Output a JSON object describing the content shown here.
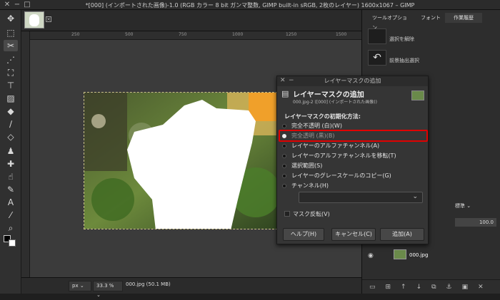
{
  "window": {
    "title": "*[000] (インポートされた画像)-1.0 (RGB カラー 8 bit ガンマ整数, GIMP built-in sRGB, 2枚のレイヤー) 1600x1067 – GIMP"
  },
  "ruler": {
    "h_labels": [
      "250",
      "500",
      "750",
      "1000",
      "1250",
      "1500"
    ]
  },
  "statusbar": {
    "unit": "px",
    "zoom": "33.3 %",
    "filename": "000.jpg (50.1 MB)"
  },
  "dock": {
    "tabs": [
      "ツールオプション",
      "フォント",
      "作業履歴"
    ],
    "history": [
      "選択を解除",
      "前景抽出選択"
    ],
    "mode": "標準",
    "opacity": "100.0",
    "layer_name": "000.jpg"
  },
  "dialog": {
    "window_title": "レイヤーマスクの追加",
    "heading": "レイヤーマスクの追加",
    "subtitle": "000.jpg-2 ([000] (インポートされた画像))",
    "section_label": "レイヤーマスクの初期化方法:",
    "options": [
      {
        "label": "完全不透明 (白)(W)",
        "selected": false
      },
      {
        "label": "完全透明 (黒)(B)",
        "selected": true
      },
      {
        "label": "レイヤーのアルファチャンネル(A)",
        "selected": false
      },
      {
        "label": "レイヤーのアルファチャンネルを移転(T)",
        "selected": false
      },
      {
        "label": "選択範囲(S)",
        "selected": false
      },
      {
        "label": "レイヤーのグレースケールのコピー(G)",
        "selected": false
      },
      {
        "label": "チャンネル(H)",
        "selected": false
      }
    ],
    "invert_label": "マスク反転(V)",
    "buttons": {
      "help": "ヘルプ(H)",
      "cancel": "キャンセル(C)",
      "add": "追加(A)"
    },
    "highlight_color": "#e00000"
  }
}
